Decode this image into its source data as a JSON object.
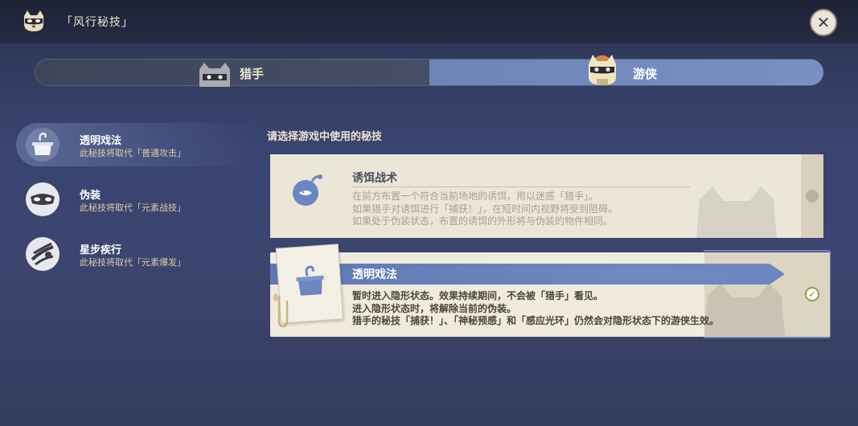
{
  "header": {
    "title": "「风行秘技」",
    "mode_icon": "raccoon-mask-icon",
    "close_icon": "close-icon"
  },
  "tabs": [
    {
      "label": "猎手",
      "selected": false,
      "icon": "hunter-cat-icon"
    },
    {
      "label": "游侠",
      "selected": true,
      "icon": "ranger-cat-icon"
    }
  ],
  "prompt": "请选择游戏中使用的秘技",
  "skills": [
    {
      "name": "透明戏法",
      "desc": "此秘技将取代「普通攻击」",
      "icon": "invisible-box-icon",
      "active": true
    },
    {
      "name": "伪装",
      "desc": "此秘技将取代「元素战技」",
      "icon": "disguise-mask-icon",
      "active": false
    },
    {
      "name": "星步疾行",
      "desc": "此秘技将取代「元素爆发」",
      "icon": "star-dash-icon",
      "active": false
    }
  ],
  "cards": [
    {
      "title": "诱饵战术",
      "selected": false,
      "icon": "bait-bomb-icon",
      "lines": [
        "在前方布置一个符合当前场地的诱饵，用以迷惑「猎手」。",
        "如果猎手对诱饵进行「捕获！」，在短时间内视野将受到阻碍。",
        "如果处于伪装状态，布置的诱饵的外形将与伪装的物件相同。"
      ]
    },
    {
      "title": "透明戏法",
      "selected": true,
      "icon": "invisible-box-icon",
      "lines": [
        "暂时进入隐形状态。效果持续期间，不会被「猎手」看见。",
        "进入隐形状态时，将解除当前的伪装。",
        "猎手的秘技「捕获！」、「神秘预感」和「感应光环」仍然会对隐形状态下的游侠生效。"
      ]
    }
  ],
  "colors": {
    "accent_blue": "#6f88c2",
    "card_bg": "#ece6d8",
    "check_green": "#7a9a2c"
  }
}
